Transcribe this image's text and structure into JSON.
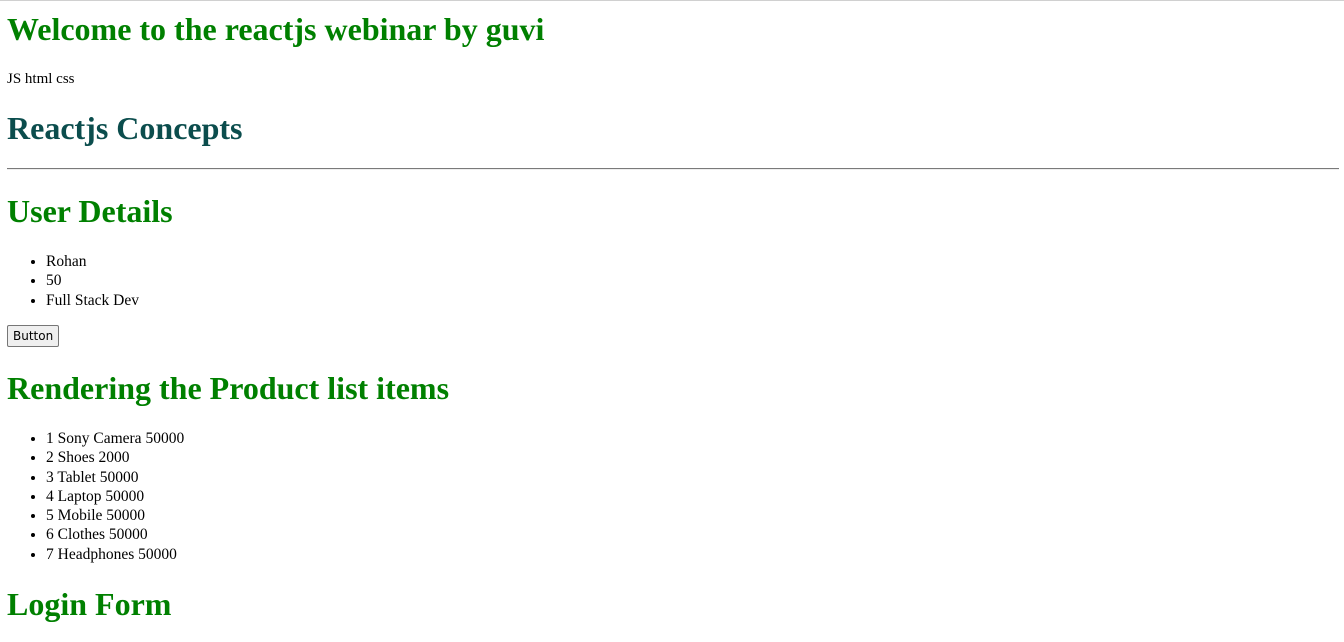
{
  "header": {
    "welcome_title": "Welcome to the reactjs webinar by guvi",
    "tech_line": "JS html css",
    "concepts_title": "Reactjs Concepts"
  },
  "user_details": {
    "title": "User Details",
    "items": [
      "Rohan",
      "50",
      "Full Stack Dev"
    ],
    "button_label": "Button"
  },
  "products": {
    "title": "Rendering the Product list items",
    "items": [
      "1 Sony Camera 50000",
      "2 Shoes 2000",
      "3 Tablet 50000",
      "4 Laptop 50000",
      "5 Mobile 50000",
      "6 Clothes 50000",
      "7 Headphones 50000"
    ]
  },
  "login": {
    "title": "Login Form"
  },
  "colors": {
    "heading_green": "#008000",
    "heading_dark_teal": "#0b4d4d"
  }
}
